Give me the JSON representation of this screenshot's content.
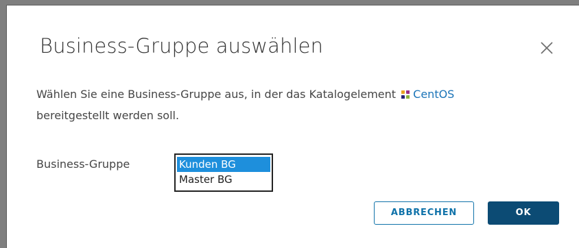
{
  "dialog": {
    "title": "Business-Gruppe auswählen",
    "close_icon": "close-icon",
    "description_line1_prefix": "Wählen Sie eine Business-Gruppe aus, in der das Katalogelement",
    "catalog_item_icon": "catalog-item-icon",
    "catalog_item_name": "CentOS",
    "description_line2": "bereitgestellt werden soll."
  },
  "form": {
    "field_label": "Business-Gruppe",
    "options": [
      "Kunden BG",
      "Master BG"
    ],
    "selected_option": "Kunden BG"
  },
  "buttons": {
    "cancel_label": "ABBRECHEN",
    "ok_label": "OK"
  },
  "colors": {
    "primary": "#0c4b74",
    "link": "#1b74b8",
    "selection": "#1e8fdc"
  }
}
